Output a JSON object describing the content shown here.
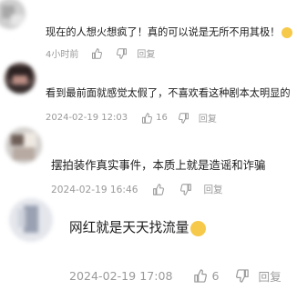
{
  "comments": [
    {
      "text": "现在的人想火想疯了！真的可以说是无所不用其极！",
      "time": "4小时前",
      "likes": "",
      "reply_label": "回复"
    },
    {
      "text": "看到最前面就感觉太假了，不喜欢看这种剧本太明显的",
      "time": "2024-02-19 12:03",
      "likes": "16",
      "reply_label": "回复"
    },
    {
      "text": "摆拍装作真实事件，本质上就是造谣和诈骗",
      "time": "2024-02-19 16:46",
      "likes": "",
      "reply_label": "回复"
    },
    {
      "text": "网红就是天天找流量",
      "time": "2024-02-19 17:08",
      "likes": "6",
      "reply_label": "回复"
    }
  ],
  "icons": {
    "like": "thumbs-up-icon",
    "dislike": "thumbs-down-icon",
    "reply": "reply-icon",
    "emoji": "grinning-face-emoji"
  },
  "colors": {
    "text": "#1b1b1b",
    "meta": "#9a9a9a",
    "emoji": "#f6c94a"
  }
}
